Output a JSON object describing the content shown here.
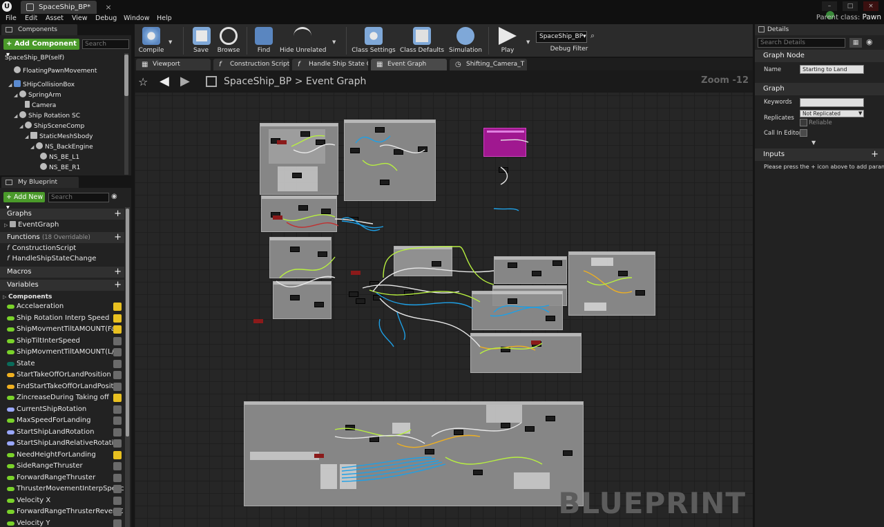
{
  "window": {
    "tab_title": "SpaceShip_BP*",
    "parent_class_label": "Parent class:",
    "parent_class_value": "Pawn"
  },
  "menu": [
    "File",
    "Edit",
    "Asset",
    "View",
    "Debug",
    "Window",
    "Help"
  ],
  "components": {
    "tab": "Components",
    "add_button": "+ Add Component ▾",
    "search_placeholder": "Search",
    "items": [
      "SpaceShip_BP(self)",
      "FloatingPawnMovement",
      "SHipCollisionBox",
      "SpringArm",
      "Camera",
      "Ship Rotation SC",
      "ShipSceneComp",
      "StaticMeshSbody",
      "NS_BackEngine",
      "NS_BE_L1",
      "NS_BE_R1"
    ]
  },
  "my_blueprint": {
    "tab": "My Blueprint",
    "add_button": "+ Add New ▾",
    "search_placeholder": "Search",
    "graphs_label": "Graphs",
    "event_graph": "EventGraph",
    "functions_label": "Functions",
    "functions_count": "(18 Overridable)",
    "functions": [
      "ConstructionScript",
      "HandleShipStateChange"
    ],
    "macros_label": "Macros",
    "variables_label": "Variables",
    "components_label": "Components",
    "variables": [
      {
        "name": "Accelaeration",
        "color": "#7ad22a",
        "visible": true
      },
      {
        "name": "Ship Rotation Interp Speed",
        "color": "#7ad22a",
        "visible": true
      },
      {
        "name": "ShipMovmentTiltAMOUNT(Fa:",
        "color": "#7ad22a",
        "visible": true
      },
      {
        "name": "ShipTiltInterSpeed",
        "color": "#7ad22a",
        "visible": false
      },
      {
        "name": "ShipMovmentTiltAMOUNT(L/F",
        "color": "#7ad22a",
        "visible": false
      },
      {
        "name": "State",
        "color": "#0a6b5a",
        "visible": false
      },
      {
        "name": "StartTakeOffOrLandPosition",
        "color": "#f0b020",
        "visible": false
      },
      {
        "name": "EndStartTakeOffOrLandPositic",
        "color": "#f0b020",
        "visible": false
      },
      {
        "name": "ZincreaseDuring Taking off",
        "color": "#7ad22a",
        "visible": true
      },
      {
        "name": "CurrentShipRotation",
        "color": "#9aa8ff",
        "visible": false
      },
      {
        "name": "MaxSpeedForLanding",
        "color": "#7ad22a",
        "visible": false
      },
      {
        "name": "StartShipLandRotation",
        "color": "#9aa8ff",
        "visible": false
      },
      {
        "name": "StartShipLandRelativeRotatioı",
        "color": "#9aa8ff",
        "visible": false
      },
      {
        "name": "NeedHeightForLanding",
        "color": "#7ad22a",
        "visible": true
      },
      {
        "name": "SideRangeThruster",
        "color": "#7ad22a",
        "visible": false
      },
      {
        "name": "ForwardRangeThruster",
        "color": "#7ad22a",
        "visible": false
      },
      {
        "name": "ThrusterMovementInterpSpeec",
        "color": "#7ad22a",
        "visible": false
      },
      {
        "name": "Velocity X",
        "color": "#7ad22a",
        "visible": false
      },
      {
        "name": "ForwardRangeThrusterRevers€",
        "color": "#7ad22a",
        "visible": false
      },
      {
        "name": "Velocity Y",
        "color": "#7ad22a",
        "visible": false
      }
    ]
  },
  "toolbar": {
    "compile": "Compile",
    "save": "Save",
    "browse": "Browse",
    "find": "Find",
    "hide_unrelated": "Hide Unrelated",
    "class_settings": "Class Settings",
    "class_defaults": "Class Defaults",
    "simulation": "Simulation",
    "play": "Play",
    "debug_select": "SpaceShip_BP▾",
    "debug_filter": "Debug Filter"
  },
  "graph_tabs": [
    "Viewport",
    "Construction Script",
    "Handle Ship State C",
    "Event Graph",
    "Shifting_Camera_T"
  ],
  "graph": {
    "breadcrumb_root": "SpaceShip_BP",
    "breadcrumb_sep": ">",
    "breadcrumb_current": "Event Graph",
    "zoom": "Zoom -12",
    "watermark": "BLUEPRINT"
  },
  "details": {
    "tab": "Details",
    "search_placeholder": "Search Details",
    "graph_node_label": "Graph Node",
    "name_label": "Name",
    "name_value": "Starting to Land",
    "graph_label": "Graph",
    "keywords_label": "Keywords",
    "replicates_label": "Replicates",
    "replicates_value": "Not Replicated",
    "reliable_label": "Reliable",
    "call_in_editor_label": "Call In Editor",
    "inputs_label": "Inputs",
    "inputs_hint": "Please press the + icon above to add parame"
  },
  "colors": {
    "accent_green": "#4a9a2a",
    "event_node": "#a01890",
    "wire_blue": "#1ea0e6",
    "wire_green": "#b8f040",
    "wire_white": "#e8e8e8"
  }
}
